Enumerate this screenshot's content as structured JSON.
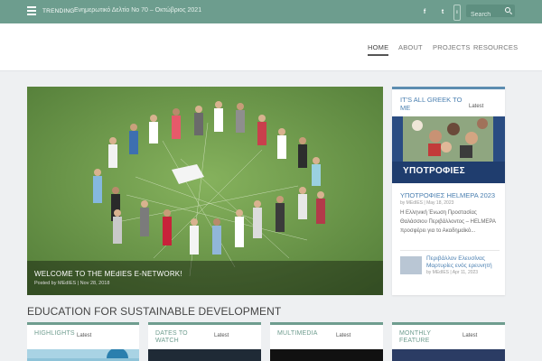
{
  "topbar": {
    "trending_label": "TRENDING",
    "trending_text": "Ενημερωτικό Δελτίο No 70 – Οκτώβριος 2021",
    "social": {
      "facebook": "f",
      "twitter": "t",
      "instagram": "i"
    },
    "search_placeholder": "Search"
  },
  "nav": {
    "items": [
      {
        "label": "HOME",
        "active": true
      },
      {
        "label": "ABOUT"
      },
      {
        "label": "PROJECTS"
      },
      {
        "label": "RESOURCES"
      }
    ]
  },
  "hero": {
    "title": "WELCOME TO THE MEdIES E-NETWORK!",
    "author": "Posted by MEdIES",
    "date": "Nov 28, 2018"
  },
  "greek": {
    "title": "IT'S ALL GREEK TO ME",
    "latest": "Latest",
    "img_text": "ΥΠΟΤΡΟΦΙΕΣ",
    "post_title": "ΥΠΟΤΡΟΦΙΕΣ HELMEPA 2023",
    "post_meta": "by MEdIES | May 18, 2023",
    "excerpt": "Η Ελληνική Ένωση Προστασίας Θαλάσσιου Περιβάλλοντος – HELMEPA προσφέρει για το Ακαδημαϊκό...",
    "post2_title": "Περιβάλλον Ελευσίνας Μαρτυρίες ενός ερευνητή",
    "post2_meta": "by MEdIES | Apr 11, 2023"
  },
  "education": {
    "title": "EDUCATION FOR SUSTAINABLE DEVELOPMENT",
    "cards": [
      {
        "title": "HIGHLIGHTS",
        "latest": "Latest"
      },
      {
        "title": "DATES TO WATCH",
        "latest": "Latest"
      },
      {
        "title": "MULTIMEDIA",
        "latest": "Latest"
      },
      {
        "title": "MONTHLY FEATURE",
        "latest": "Latest"
      }
    ]
  },
  "colors": {
    "topbar": "#6d9d8e",
    "accent_blue": "#4a7fb0",
    "accent_green": "#6f9d8f"
  }
}
